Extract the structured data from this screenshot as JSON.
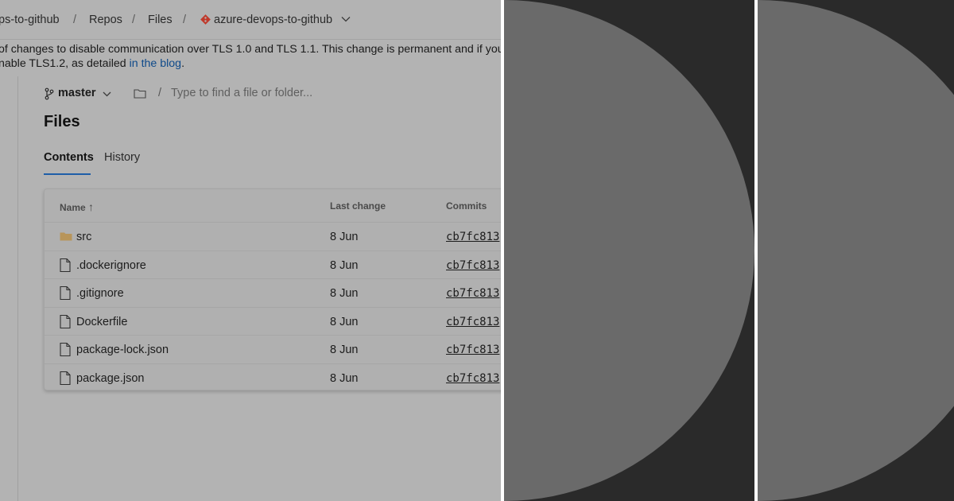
{
  "breadcrumb": {
    "project": "ps-to-github",
    "repos": "Repos",
    "files": "Files",
    "repository": "azure-devops-to-github",
    "separator": "/"
  },
  "banner": {
    "line1": "of changes to disable communication over TLS 1.0 and TLS 1.1. This change is permanent and if your t",
    "line2_prefix": "nable TLS1.2, as detailed ",
    "link_text": "in the blog",
    "line2_suffix": "."
  },
  "branch": {
    "name": "master",
    "path_separator": "/",
    "search_placeholder": "Type to find a file or folder..."
  },
  "page_title": "Files",
  "tabs": [
    {
      "label": "Contents",
      "active": true
    },
    {
      "label": "History",
      "active": false
    }
  ],
  "table": {
    "columns": {
      "name": "Name",
      "sort_indicator": "↑",
      "last_change": "Last change",
      "commits": "Commits"
    },
    "rows": [
      {
        "type": "folder",
        "name": "src",
        "last_change": "8 Jun",
        "commit": "cb7fc813"
      },
      {
        "type": "file",
        "name": ".dockerignore",
        "last_change": "8 Jun",
        "commit": "cb7fc813"
      },
      {
        "type": "file",
        "name": ".gitignore",
        "last_change": "8 Jun",
        "commit": "cb7fc813"
      },
      {
        "type": "file",
        "name": "Dockerfile",
        "last_change": "8 Jun",
        "commit": "cb7fc813"
      },
      {
        "type": "file",
        "name": "package-lock.json",
        "last_change": "8 Jun",
        "commit": "cb7fc813"
      },
      {
        "type": "file",
        "name": "package.json",
        "last_change": "8 Jun",
        "commit": "cb7fc813"
      }
    ]
  },
  "icons": {
    "repo": "git-repo-icon",
    "branch": "git-branch-icon",
    "folder": "folder-icon",
    "file": "file-icon",
    "chevron": "chevron-down-icon"
  },
  "colors": {
    "panel_background": "#b3b3b3",
    "link": "#0f4a8a",
    "active_tab_underline": "#1e5ea8",
    "repo_icon": "#c0392b",
    "folder_icon": "#b8955a",
    "dark_panel": "#2a2a2a",
    "half_circle": "#6a6a6a"
  }
}
